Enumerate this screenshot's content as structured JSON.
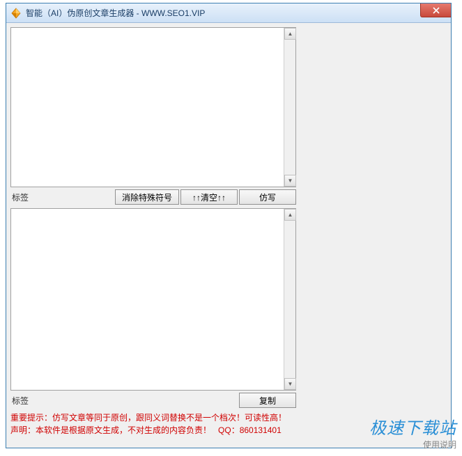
{
  "window": {
    "title": "智能（AI）伪原创文章生成器 - WWW.SEO1.VIP"
  },
  "top_panel": {
    "label": "标签",
    "buttons": {
      "remove_special": "消除特殊符号",
      "clear": "↑↑清空↑↑",
      "rewrite": "仿写"
    }
  },
  "bottom_panel": {
    "label": "标签",
    "buttons": {
      "copy": "复制"
    }
  },
  "footer": {
    "line1": "重要提示：仿写文章等同于原创，跟同义词替换不是一个档次！可读性高！",
    "line2_prefix": "声明：本软件是根据原文生成，不对生成的内容负责！",
    "line2_qq_label": "QQ：",
    "line2_qq": "860131401"
  },
  "watermark": {
    "main": "极速下载站",
    "sub": "使用说明"
  }
}
